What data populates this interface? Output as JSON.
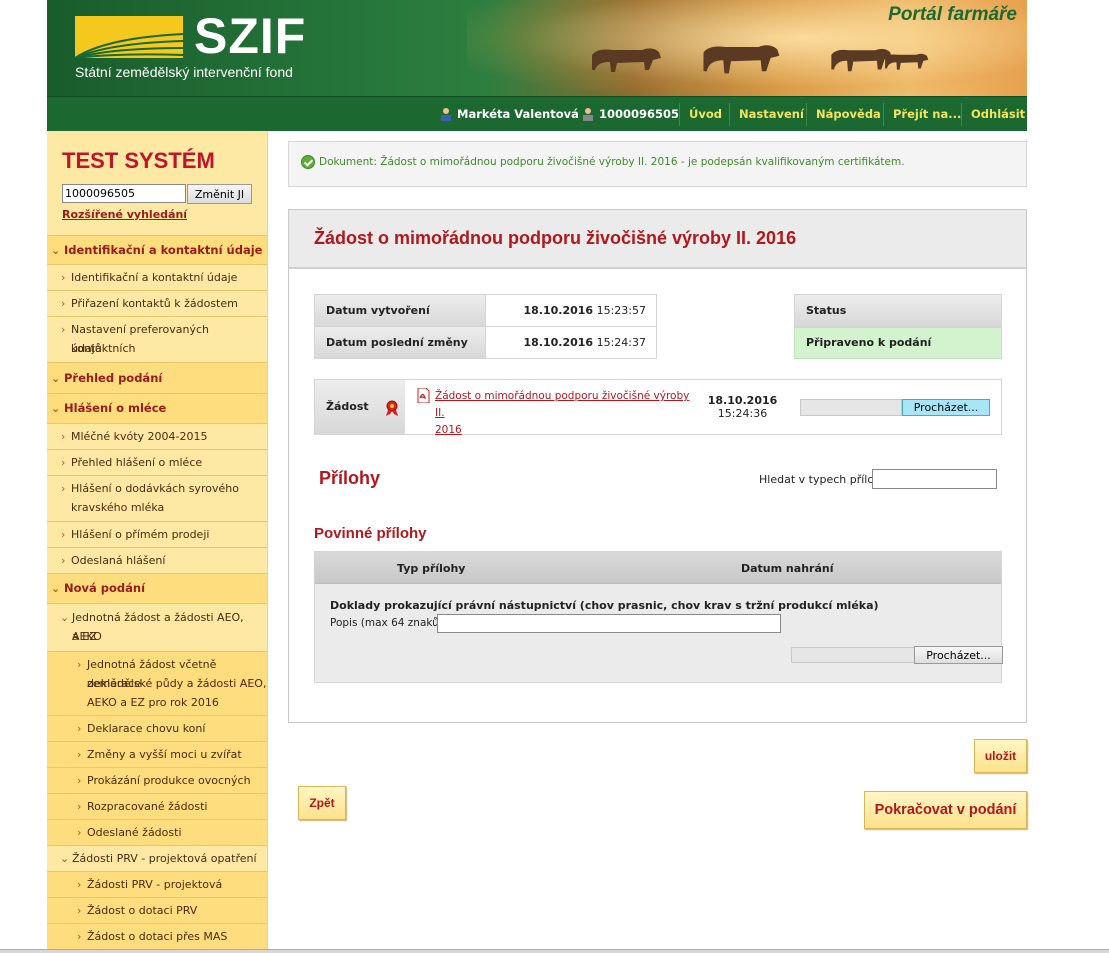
{
  "header": {
    "logo_text": "SZIF",
    "logo_subtitle": "Státní zemědělský intervenční fond",
    "portal_title": "Portál farmáře"
  },
  "navbar": {
    "user_name": "Markéta Valentová",
    "user_id": "1000096505",
    "items": [
      "Úvod",
      "Nastavení",
      "Nápověda",
      "Přejít na...",
      "Odhlásit"
    ]
  },
  "sidebar": {
    "system_label": "TEST SYSTÉM",
    "search_value": "1000096505",
    "change_button": "Změnit JI",
    "advanced_search": "Rozšířené vyhledání",
    "menu": [
      {
        "label": "Identifikační a kontaktní údaje"
      },
      {
        "label": "Identifikační a kontaktní údaje"
      },
      {
        "label": "Přiřazení kontaktů k žádostem"
      },
      {
        "label": "Nastavení preferovaných kontaktních",
        "label2": "údajů"
      },
      {
        "label": "Přehled podání"
      },
      {
        "label": "Hlášení o mléce"
      },
      {
        "label": "Mléčné kvóty 2004-2015"
      },
      {
        "label": "Přehled hlášení o mléce"
      },
      {
        "label": "Hlášení o dodávkách syrového",
        "label2": "kravského mléka"
      },
      {
        "label": "Hlášení o přímém prodeji"
      },
      {
        "label": "Odeslaná hlášení"
      },
      {
        "label": "Nová podání"
      },
      {
        "label": "Jednotná žádost a žádosti AEO, AEKO",
        "label2": "a EZ"
      },
      {
        "label": "Jednotná žádost včetně deklarace",
        "label2": "zemědělské půdy a žádosti AEO,",
        "label3": "AEKO a EZ pro rok 2016"
      },
      {
        "label": "Deklarace chovu koní"
      },
      {
        "label": "Změny a vyšší moci u zvířat"
      },
      {
        "label": "Prokázání produkce ovocných druhů"
      },
      {
        "label": "Rozpracované žádosti"
      },
      {
        "label": "Odeslané žádosti"
      },
      {
        "label": "Žádosti PRV - projektová opatření"
      },
      {
        "label": "Žádosti PRV - projektová opatření"
      },
      {
        "label": "Žádost o dotaci PRV"
      },
      {
        "label": "Žádost o dotaci přes MAS"
      }
    ]
  },
  "message": "Dokument: Žádost o mimořádnou podporu živočišné výroby II. 2016 - je podepsán kvalifikovaným certifikátem.",
  "panel": {
    "title": "Žádost o mimořádnou podporu živočišné výroby II. 2016",
    "created_label": "Datum vytvoření",
    "created_date": "18.10.2016",
    "created_time": "15:23:57",
    "changed_label": "Datum poslední změny",
    "changed_date": "18.10.2016",
    "changed_time": "15:24:37",
    "status_label": "Status",
    "status_value": "Připraveno k podání",
    "zadost_label": "Žádost",
    "zadost_link_1": "Žádost o mimořádnou podporu živočišné výroby II.",
    "zadost_link_2": "2016",
    "zadost_date": "18.10.2016",
    "zadost_time": "15:24:36",
    "browse_label": "Procházet...",
    "attachments_heading": "Přílohy",
    "search_types_label": "Hledat v typech příloh:",
    "search_types_value": "",
    "required_heading": "Povinné přílohy",
    "col_type": "Typ přílohy",
    "col_date": "Datum nahrání",
    "attachment_desc": "Doklady prokazující právní nástupnictví (chov prasnic, chov krav s tržní produkcí mléka)",
    "popis_label": "Popis (max 64 znaků):",
    "popis_value": "",
    "browse_label_2": "Procházet..."
  },
  "buttons": {
    "save": "uložit",
    "back": "Zpět",
    "continue": "Pokračovat v podání"
  },
  "colors": {
    "brand_green": "#1b6930",
    "accent_red": "#b0181e",
    "sidebar_bg": "#fce9a0",
    "status_green": "#d2f3cd"
  }
}
